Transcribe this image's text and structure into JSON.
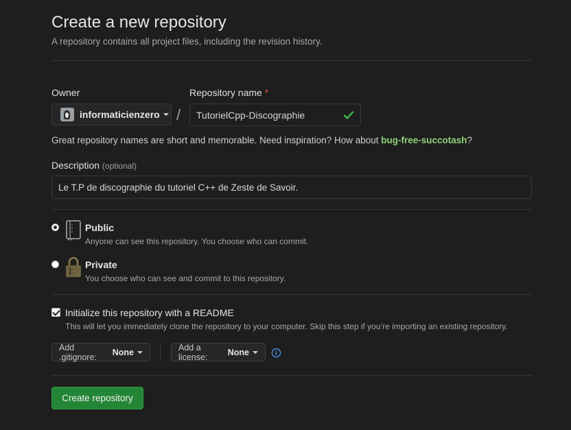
{
  "header": {
    "title": "Create a new repository",
    "subtitle": "A repository contains all project files, including the revision history."
  },
  "owner": {
    "label": "Owner",
    "value": "informaticienzero",
    "avatar_icon": "user-avatar"
  },
  "repo_name": {
    "label": "Repository name",
    "required_marker": "*",
    "value": "TutorielCpp-Discographie",
    "valid_icon": "check-icon"
  },
  "separator": "/",
  "hint": {
    "text": "Great repository names are short and memorable. Need inspiration? How about ",
    "suggestion": "bug-free-succotash",
    "suffix": "?"
  },
  "description": {
    "label": "Description",
    "optional": "(optional)",
    "value": "Le T.P de discographie du tutoriel C++ de Zeste de Savoir."
  },
  "visibility": {
    "selected": "public",
    "options": [
      {
        "id": "public",
        "title": "Public",
        "description": "Anyone can see this repository. You choose who can commit.",
        "icon": "repo-book-icon"
      },
      {
        "id": "private",
        "title": "Private",
        "description": "You choose who can see and commit to this repository.",
        "icon": "lock-icon"
      }
    ]
  },
  "readme": {
    "checked": true,
    "title": "Initialize this repository with a README",
    "description": "This will let you immediately clone the repository to your computer. Skip this step if you’re importing an existing repository."
  },
  "gitignore": {
    "label": "Add .gitignore:",
    "value": "None"
  },
  "license": {
    "label": "Add a license:",
    "value": "None"
  },
  "submit": {
    "label": "Create repository"
  },
  "colors": {
    "background": "#1e1e1e",
    "accent_green": "#238636",
    "suggestion_green": "#8fd27a",
    "required_red": "#e5534b",
    "info_blue": "#4a90e2"
  }
}
